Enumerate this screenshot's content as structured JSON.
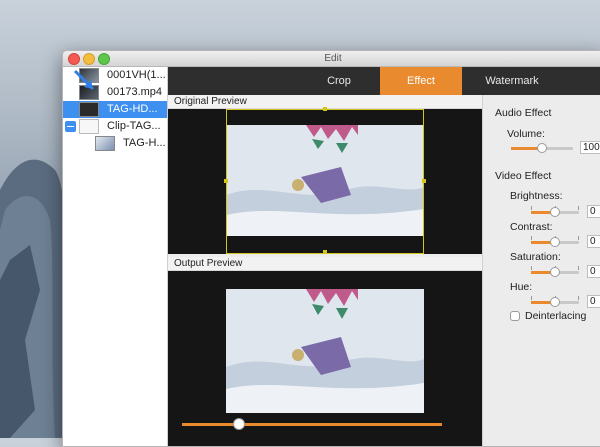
{
  "window": {
    "title": "Edit"
  },
  "files": [
    {
      "label": "0001VH(1...",
      "selected": false
    },
    {
      "label": "00173.mp4",
      "selected": false
    },
    {
      "label": "TAG-HD...",
      "selected": true
    },
    {
      "label": "Clip-TAG...",
      "selected": false
    },
    {
      "label": "TAG-H...",
      "selected": false
    }
  ],
  "tabs": [
    {
      "label": "Crop",
      "active": false
    },
    {
      "label": "Effect",
      "active": true
    },
    {
      "label": "Watermark",
      "active": false
    }
  ],
  "preview": {
    "original_label": "Original Preview",
    "output_label": "Output Preview"
  },
  "audio": {
    "heading": "Audio Effect",
    "volume_label": "Volume:",
    "volume_value": "100",
    "volume_level": 0.5
  },
  "video": {
    "heading": "Video Effect",
    "brightness_label": "Brightness:",
    "brightness_value": "0",
    "contrast_label": "Contrast:",
    "contrast_value": "0",
    "saturation_label": "Saturation:",
    "saturation_value": "0",
    "hue_label": "Hue:",
    "hue_value": "0",
    "deinterlacing_label": "Deinterlacing",
    "deinterlacing_checked": false
  },
  "playback": {
    "position": 0.22
  },
  "colors": {
    "accent": "#e98a2e",
    "selection": "#3d8ff0",
    "tabbar": "#2e2e2e",
    "crop_frame": "#d2c51c"
  }
}
